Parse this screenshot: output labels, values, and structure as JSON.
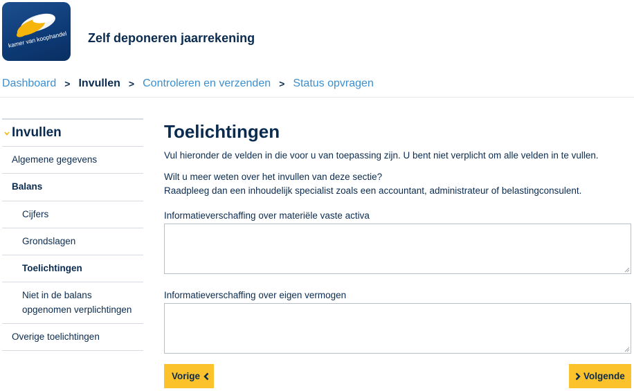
{
  "brand": {
    "logo_text": "kamer van koophandel",
    "colors": {
      "navy": "#0a2b4f",
      "link": "#3a8fd0",
      "accent": "#fbc22b",
      "logo_bg": "#0d3a75"
    }
  },
  "header": {
    "app_title": "Zelf deponeren jaarrekening"
  },
  "breadcrumb": {
    "items": [
      {
        "label": "Dashboard"
      },
      {
        "label": "Invullen"
      },
      {
        "label": "Controleren en verzenden"
      },
      {
        "label": "Status opvragen"
      }
    ],
    "separator": ">"
  },
  "sidebar": {
    "heading": "Invullen",
    "items": [
      {
        "label": "Algemene gegevens"
      },
      {
        "label": "Balans"
      },
      {
        "label": "Cijfers"
      },
      {
        "label": "Grondslagen"
      },
      {
        "label": "Toelichtingen"
      },
      {
        "label": "Niet in de balans opgenomen verplichtingen"
      },
      {
        "label": "Overige toelichtingen"
      }
    ]
  },
  "main": {
    "title": "Toelichtingen",
    "intro": "Vul hieronder de velden in die voor u van toepassing zijn. U bent niet verplicht om alle velden in te vullen.",
    "help_line1": "Wilt u meer weten over het invullen van deze sectie?",
    "help_line2": "Raadpleeg dan een inhoudelijk specialist zoals een accountant, administrateur of belastingconsulent.",
    "fields": [
      {
        "label": "Informatieverschaffing over materiële vaste activa",
        "value": ""
      },
      {
        "label": "Informatieverschaffing over eigen vermogen",
        "value": ""
      }
    ]
  },
  "buttons": {
    "prev_label": "Vorige",
    "next_label": "Volgende"
  }
}
